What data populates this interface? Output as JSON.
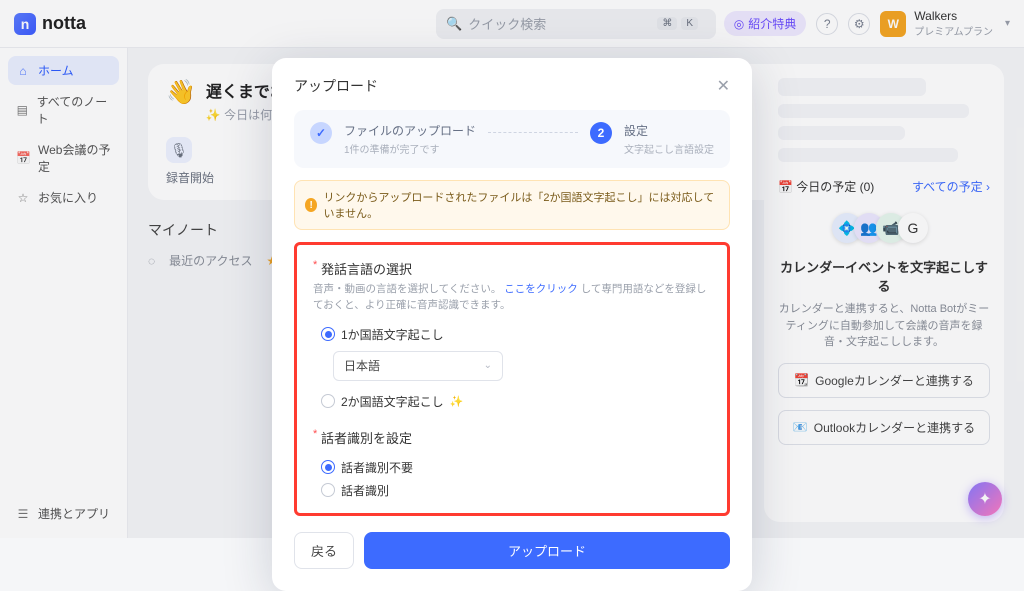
{
  "brand": {
    "name": "notta",
    "mark": "n"
  },
  "search": {
    "placeholder": "クイック検索",
    "kbd1": "⌘",
    "kbd2": "K"
  },
  "topbar": {
    "referral_label": "紹介特典",
    "referral_icon": "◎",
    "user_initial": "W",
    "user_name": "Walkers",
    "user_plan": "プレミアムプラン"
  },
  "nav": {
    "home": "ホーム",
    "all_notes": "すべてのノート",
    "meetings": "Web会議の予定",
    "favorites": "お気に入り",
    "integrations": "連携とアプリ"
  },
  "greeting": {
    "title": "遅くまでお疲れ様です",
    "sub_prefix": "✨ 今日は何を作りますか",
    "record": "録音開始"
  },
  "mynotes": {
    "label": "マイノート",
    "recent": "最近のアクセス"
  },
  "right": {
    "today_label": "今日の予定 (0)",
    "all_label": "すべての予定",
    "cal_title": "カレンダーイベントを文字起こしする",
    "cal_desc": "カレンダーと連携すると、Notta Botがミーティングに自動参加して会議の音声を録音・文字起こしします。",
    "google_btn": "Googleカレンダーと連携する",
    "outlook_btn": "Outlookカレンダーと連携する"
  },
  "modal": {
    "title": "アップロード",
    "step1_label": "ファイルのアップロード",
    "step1_sub": "1件の準備が完了です",
    "step2_num": "2",
    "step2_label": "設定",
    "step2_sub": "文字起こし言語設定",
    "warning": "リンクからアップロードされたファイルは「2か国語文字起こし」には対応していません。",
    "lang_section": "発話言語の選択",
    "lang_desc_a": "音声・動画の言語を選択してください。",
    "lang_desc_link": "ここをクリック",
    "lang_desc_b": "して専門用語などを登録しておくと、より正確に音声認識できます。",
    "radio_single": "1か国語文字起こし",
    "select_value": "日本語",
    "radio_dual": "2か国語文字起こし",
    "speaker_section": "話者識別を設定",
    "speaker_none": "話者識別不要",
    "speaker_on": "話者識別",
    "back_btn": "戻る",
    "upload_btn": "アップロード"
  }
}
